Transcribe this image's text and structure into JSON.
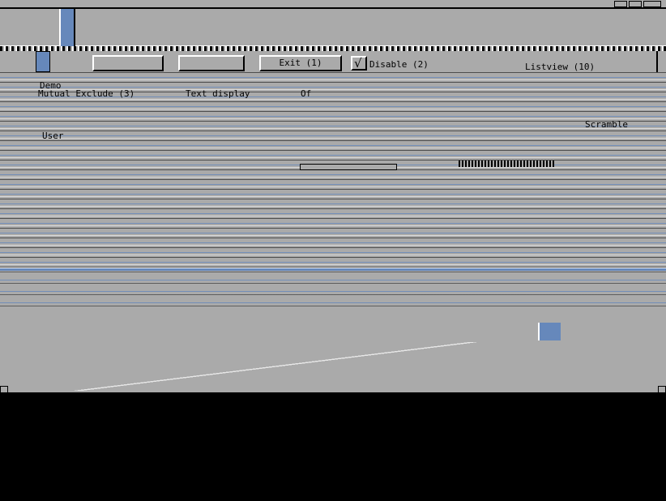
{
  "window": {
    "buttons": [
      "",
      ""
    ],
    "exit_label": "Exit (1)",
    "disable_label": "Disable (2)",
    "listview_label": "Listview (10)"
  },
  "labels": {
    "demo": "Demo",
    "mutual_exclude": "Mutual Exclude (3)",
    "text_display": "Text display",
    "of": "Of",
    "user": "User",
    "scramble": "Scramble"
  },
  "colors": {
    "background": "#aaaaaa",
    "accent": "#6688bb",
    "desktop": "#000000"
  },
  "icons": {
    "check": "check-mark-icon"
  }
}
